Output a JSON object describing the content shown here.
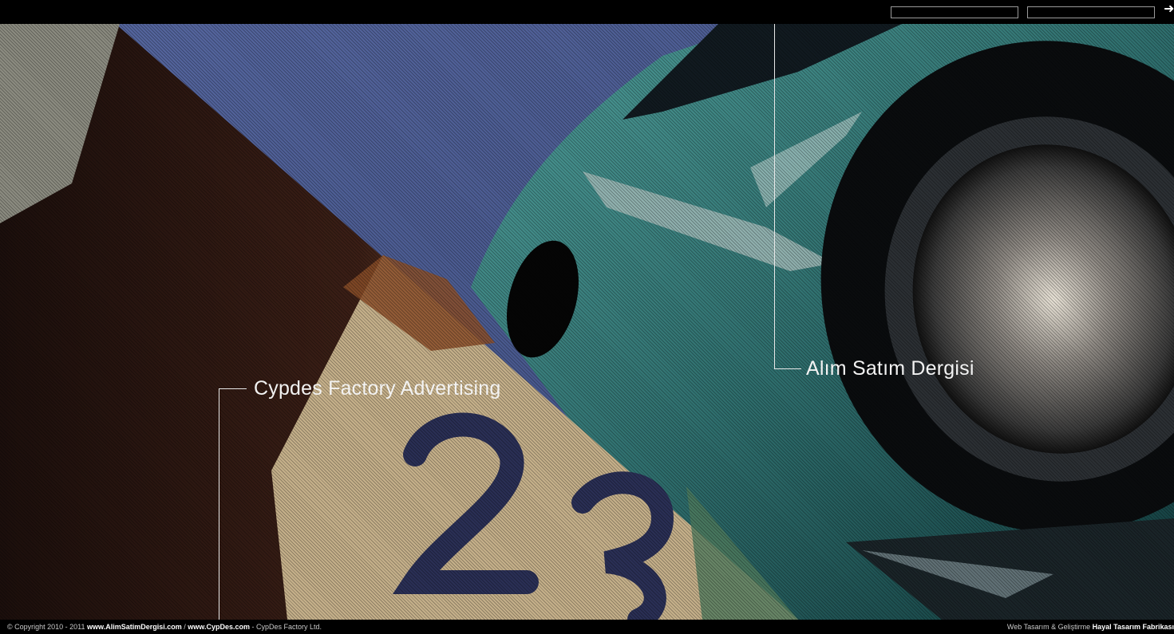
{
  "login": {
    "username_value": "",
    "password_value": "",
    "submit_icon": "arrow-right-icon",
    "submit_glyph": "➜"
  },
  "hero": {
    "callout_left": "Cypdes Factory Advertising",
    "callout_right": "Alım Satım Dergisi"
  },
  "footer": {
    "copyright": "© Copyright 2010 - 2011",
    "link1": "www.AlimSatimDergisi.com",
    "separator": "/",
    "link2": "www.CypDes.com",
    "company": "- CypDes Factory Ltd.",
    "credit_prefix": "Web Tasarım & Geliştirme",
    "credit_name": "Hayal Tasarım Fabrikası"
  },
  "colors": {
    "sky": "#4a5a8f",
    "car_teal": "#3f8a88",
    "wood": "#7a4a2a",
    "sign_cream": "#c9b48a",
    "callout_text": "#f2f2f2"
  }
}
